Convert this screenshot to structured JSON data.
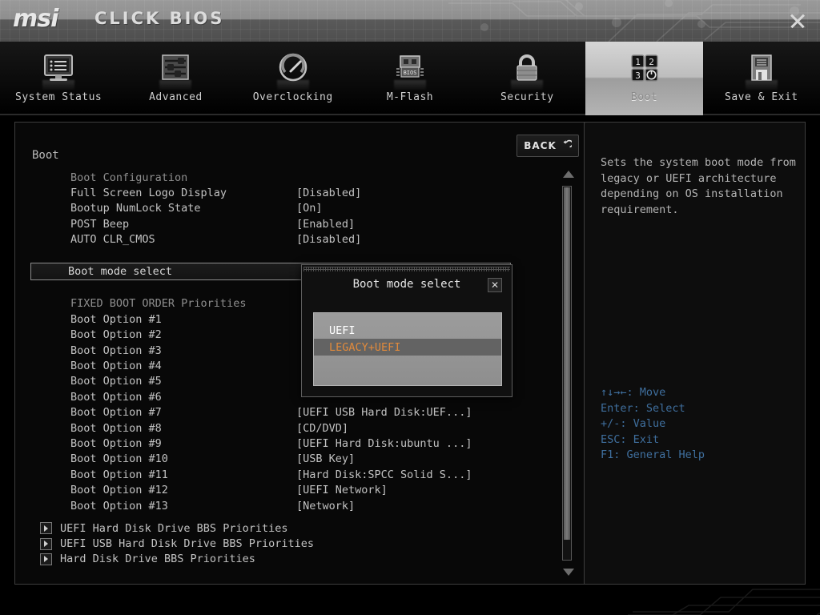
{
  "brand": {
    "msi": "msi",
    "suite": "CLICK BIOS",
    "close_icon": "window-close-icon"
  },
  "nav": {
    "items": [
      {
        "label": "System Status",
        "icon": "monitor-icon",
        "active": false
      },
      {
        "label": "Advanced",
        "icon": "sliders-icon",
        "active": false
      },
      {
        "label": "Overclocking",
        "icon": "gauge-icon",
        "active": false
      },
      {
        "label": "M-Flash",
        "icon": "usb-bios-icon",
        "active": false
      },
      {
        "label": "Security",
        "icon": "lock-icon",
        "active": false
      },
      {
        "label": "Boot",
        "icon": "boot-order-icon",
        "active": true
      },
      {
        "label": "Save & Exit",
        "icon": "floppy-icon",
        "active": false
      }
    ]
  },
  "page": {
    "title": "Boot",
    "back_label": "BACK",
    "back_icon": "undo-arrow-icon"
  },
  "settings": [
    {
      "label": "Boot Configuration",
      "value": "",
      "type": "group"
    },
    {
      "label": "Full Screen Logo Display",
      "value": "[Disabled]",
      "type": "item"
    },
    {
      "label": "Bootup NumLock State",
      "value": "[On]",
      "type": "item"
    },
    {
      "label": "POST Beep",
      "value": "[Enabled]",
      "type": "item"
    },
    {
      "label": "AUTO CLR_CMOS",
      "value": "[Disabled]",
      "type": "item"
    },
    {
      "label": "",
      "value": "",
      "type": "spacer"
    },
    {
      "label": "Boot mode select",
      "value": "",
      "type": "selected"
    },
    {
      "label": "",
      "value": "",
      "type": "spacer"
    },
    {
      "label": "FIXED BOOT ORDER Priorities",
      "value": "",
      "type": "group"
    },
    {
      "label": "Boot Option #1",
      "value": "",
      "type": "item"
    },
    {
      "label": "Boot Option #2",
      "value": "",
      "type": "item"
    },
    {
      "label": "Boot Option #3",
      "value": "",
      "type": "item"
    },
    {
      "label": "Boot Option #4",
      "value": "",
      "type": "item"
    },
    {
      "label": "Boot Option #5",
      "value": "",
      "type": "item"
    },
    {
      "label": "Boot Option #6",
      "value": "",
      "type": "item"
    },
    {
      "label": "Boot Option #7",
      "value": "[UEFI USB Hard Disk:UEF...]",
      "type": "item"
    },
    {
      "label": "Boot Option #8",
      "value": "[CD/DVD]",
      "type": "item"
    },
    {
      "label": "Boot Option #9",
      "value": "[UEFI Hard Disk:ubuntu ...]",
      "type": "item"
    },
    {
      "label": "Boot Option #10",
      "value": "[USB Key]",
      "type": "item"
    },
    {
      "label": "Boot Option #11",
      "value": "[Hard Disk:SPCC Solid S...]",
      "type": "item"
    },
    {
      "label": "Boot Option #12",
      "value": "[UEFI Network]",
      "type": "item"
    },
    {
      "label": "Boot Option #13",
      "value": "[Network]",
      "type": "item"
    }
  ],
  "submenus": [
    {
      "label": "UEFI Hard Disk Drive BBS Priorities",
      "icon": "submenu-arrow-icon"
    },
    {
      "label": "UEFI USB Hard Disk Drive BBS Priorities",
      "icon": "submenu-arrow-icon"
    },
    {
      "label": "Hard Disk Drive BBS Priorities",
      "icon": "submenu-arrow-icon"
    }
  ],
  "help": {
    "description": "Sets the system boot mode from legacy or UEFI architecture depending on OS installation requirement.",
    "keys": [
      "↑↓→←: Move",
      "Enter: Select",
      "+/-: Value",
      "ESC: Exit",
      "F1: General Help"
    ]
  },
  "modal": {
    "title": "Boot mode select",
    "close_icon": "dialog-close-icon",
    "options": [
      {
        "label": "UEFI",
        "selected": false
      },
      {
        "label": "LEGACY+UEFI",
        "selected": true
      }
    ]
  },
  "colors": {
    "highlight_orange": "#e08a3c",
    "help_blue": "#3f6f9e",
    "accent_gray": "#9c9c9c"
  }
}
